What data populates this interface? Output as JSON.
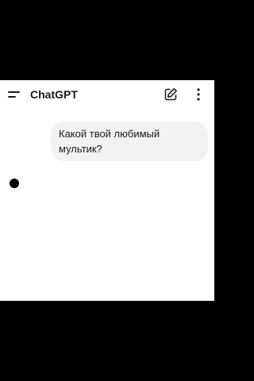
{
  "header": {
    "title": "ChatGPT",
    "menu_icon": "menu-icon",
    "edit_icon": "edit-icon",
    "more_icon": "more-vertical-icon"
  },
  "chat": {
    "user_message": "Какой твой любимый\nмультик?"
  },
  "colors": {
    "background": "#ffffff",
    "bubble": "#f2f2f2",
    "text": "#1a1a1a",
    "letterbox": "#000000"
  }
}
